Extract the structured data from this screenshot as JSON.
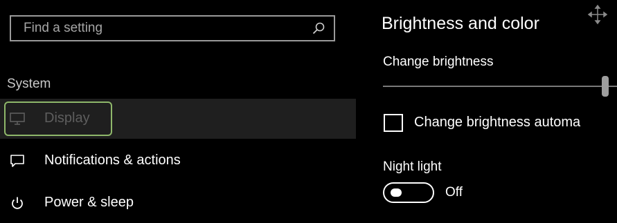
{
  "search": {
    "placeholder": "Find a setting",
    "icon": "search-icon"
  },
  "nav": {
    "section_heading": "System",
    "items": [
      {
        "label": "Display",
        "icon": "monitor-icon",
        "selected": true
      },
      {
        "label": "Notifications & actions",
        "icon": "message-icon",
        "selected": false
      },
      {
        "label": "Power & sleep",
        "icon": "power-icon",
        "selected": false
      }
    ]
  },
  "content": {
    "title": "Brightness and color",
    "brightness": {
      "label": "Change brightness",
      "value_fraction": 0.95
    },
    "auto_brightness": {
      "label": "Change brightness automa",
      "checked": false
    },
    "night_light": {
      "label": "Night light",
      "state": "Off"
    }
  },
  "colors": {
    "background": "#000000",
    "selected_background": "#1f1f1f",
    "focus_ring": "#8fb86a",
    "text": "#ffffff",
    "muted_text": "#c8c8c8"
  }
}
